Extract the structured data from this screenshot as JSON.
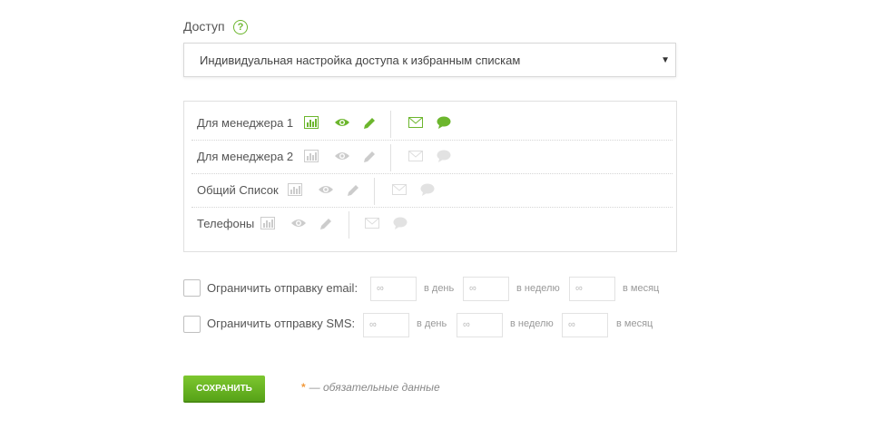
{
  "access": {
    "label": "Доступ",
    "help_icon": "?",
    "select_value": "Индивидуальная настройка доступа к избранным спискам",
    "select_arrow": "▼"
  },
  "lists": [
    {
      "name": "Для менеджера 1",
      "active": true
    },
    {
      "name": "Для менеджера 2",
      "active": false
    },
    {
      "name": "Общий Список",
      "active": false
    },
    {
      "name": "Телефоны",
      "active": false
    }
  ],
  "icons": [
    "stats-icon",
    "eye-icon",
    "pencil-icon",
    "envelope-icon",
    "chat-icon"
  ],
  "colors": {
    "active": "#6cb62d",
    "inactive": "#cccccc",
    "accent_star": "#f29a3c"
  },
  "limits": {
    "email": {
      "label": "Ограничить отправку email:",
      "placeholder": "∞",
      "per_day": "в день",
      "per_week": "в неделю",
      "per_month": "в месяц"
    },
    "sms": {
      "label": "Ограничить отправку SMS:",
      "placeholder": "∞",
      "per_day": "в день",
      "per_week": "в неделю",
      "per_month": "в месяц"
    }
  },
  "save_button": "СОХРАНИТЬ",
  "required_note": {
    "star": "*",
    "text": "— обязательные данные"
  }
}
